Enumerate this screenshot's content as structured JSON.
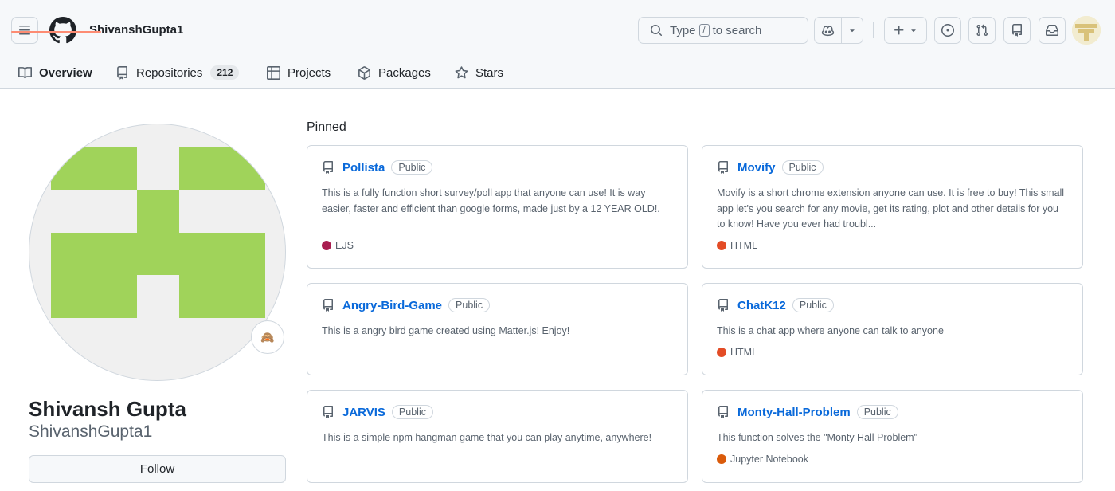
{
  "header": {
    "username": "ShivanshGupta1",
    "search": {
      "prefix": "Type",
      "key": "/",
      "suffix": "to search"
    }
  },
  "tabs": [
    {
      "label": "Overview",
      "icon": "book-icon",
      "active": true
    },
    {
      "label": "Repositories",
      "icon": "repo-icon",
      "count": "212"
    },
    {
      "label": "Projects",
      "icon": "table-icon"
    },
    {
      "label": "Packages",
      "icon": "package-icon"
    },
    {
      "label": "Stars",
      "icon": "star-icon"
    }
  ],
  "profile": {
    "name": "Shivansh Gupta",
    "login": "ShivanshGupta1",
    "follow_label": "Follow",
    "status_icon": "🙈",
    "avatar_color": "#a0d35a"
  },
  "pinned": {
    "title": "Pinned",
    "repos": [
      {
        "name": "Pollista",
        "visibility": "Public",
        "description": "This is a fully function short survey/poll app that anyone can use! It is way easier, faster and efficient than google forms, made just by a 12 YEAR OLD!.",
        "language": "EJS",
        "language_color": "#a91e50"
      },
      {
        "name": "Movify",
        "visibility": "Public",
        "description": "Movify is a short chrome extension anyone can use. It is free to buy! This small app let's you search for any movie, get its rating, plot and other details for you to know! Have you ever had troubl...",
        "language": "HTML",
        "language_color": "#e34c26"
      },
      {
        "name": "Angry-Bird-Game",
        "visibility": "Public",
        "description": "This is a angry bird game created using Matter.js! Enjoy!",
        "language": "",
        "language_color": ""
      },
      {
        "name": "ChatK12",
        "visibility": "Public",
        "description": "This is a chat app where anyone can talk to anyone",
        "language": "HTML",
        "language_color": "#e34c26"
      },
      {
        "name": "JARVIS",
        "visibility": "Public",
        "description": "This is a simple npm hangman game that you can play anytime, anywhere!",
        "language": "",
        "language_color": ""
      },
      {
        "name": "Monty-Hall-Problem",
        "visibility": "Public",
        "description": "This function solves the \"Monty Hall Problem\"",
        "language": "Jupyter Notebook",
        "language_color": "#da5b0b"
      }
    ]
  }
}
